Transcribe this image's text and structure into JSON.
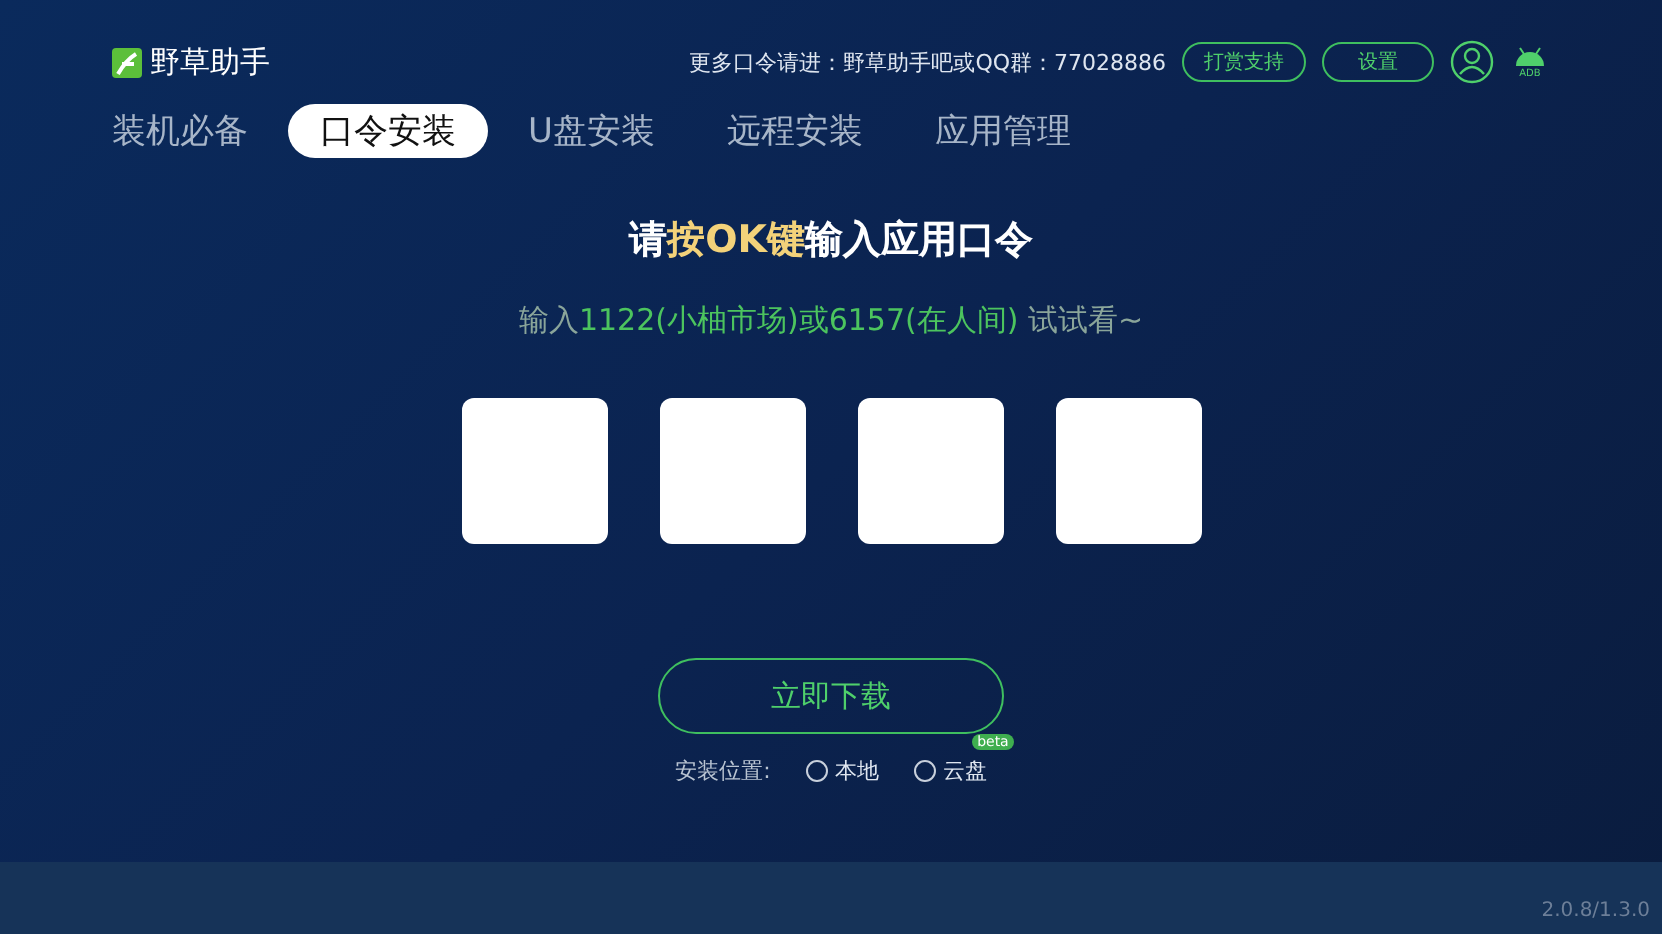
{
  "app": {
    "name": "野草助手"
  },
  "header": {
    "notice": "更多口令请进：野草助手吧或QQ群：77028886",
    "buttons": [
      "打赏支持",
      "设置"
    ],
    "adb_label": "ADB"
  },
  "tabs": [
    {
      "label": "装机必备",
      "selected": false
    },
    {
      "label": "口令安装",
      "selected": true
    },
    {
      "label": "U盘安装",
      "selected": false
    },
    {
      "label": "远程安装",
      "selected": false
    },
    {
      "label": "应用管理",
      "selected": false
    }
  ],
  "headline": [
    {
      "text": "请",
      "highlight": false
    },
    {
      "text": "按OK键",
      "highlight": true
    },
    {
      "text": "输入应用口令",
      "highlight": false
    }
  ],
  "hint": [
    {
      "text": "输入",
      "highlight": false
    },
    {
      "text": "1122(小柚市场)或6157(在人间)",
      "highlight": true
    },
    {
      "text": " 试试看~",
      "highlight": false
    }
  ],
  "code_boxes": [
    {
      "kind": "digit"
    },
    {
      "kind": "digit"
    },
    {
      "kind": "digit"
    },
    {
      "kind": "digit"
    }
  ],
  "download_button": "立即下载",
  "install_location": {
    "label": "安装位置:",
    "options": [
      {
        "label": "本地",
        "selected": false
      },
      {
        "label": "云盘",
        "selected": false,
        "badge": "beta"
      }
    ]
  },
  "version": "2.0.8/1.3.0"
}
